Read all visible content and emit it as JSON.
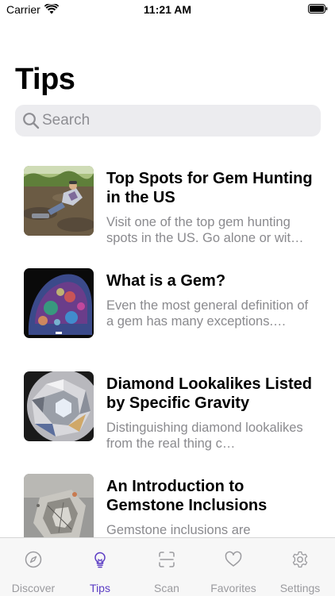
{
  "status_bar": {
    "carrier": "Carrier",
    "time": "11:21 AM"
  },
  "page": {
    "title": "Tips"
  },
  "search": {
    "placeholder": "Search"
  },
  "tips": [
    {
      "title": "Top Spots for Gem Hunting in the US",
      "description": "Visit one of the top gem hunting spots in the US. Go alone or wit…"
    },
    {
      "title": "What is a Gem?",
      "description": "Even the most general definition of a gem has many exceptions.…"
    },
    {
      "title": "Diamond Lookalikes Listed by Specific Gravity",
      "description": "Distinguishing diamond lookalikes from the real thing c…"
    },
    {
      "title": "An Introduction to Gemstone Inclusions",
      "description": "Gemstone inclusions are"
    }
  ],
  "tab_bar": {
    "active_color": "#5b3dc4",
    "inactive_color": "#9b9b9f",
    "tabs": [
      {
        "label": "Discover",
        "icon": "compass-icon"
      },
      {
        "label": "Tips",
        "icon": "lightbulb-icon",
        "active": true
      },
      {
        "label": "Scan",
        "icon": "scan-icon"
      },
      {
        "label": "Favorites",
        "icon": "heart-icon"
      },
      {
        "label": "Settings",
        "icon": "gear-icon"
      }
    ]
  }
}
